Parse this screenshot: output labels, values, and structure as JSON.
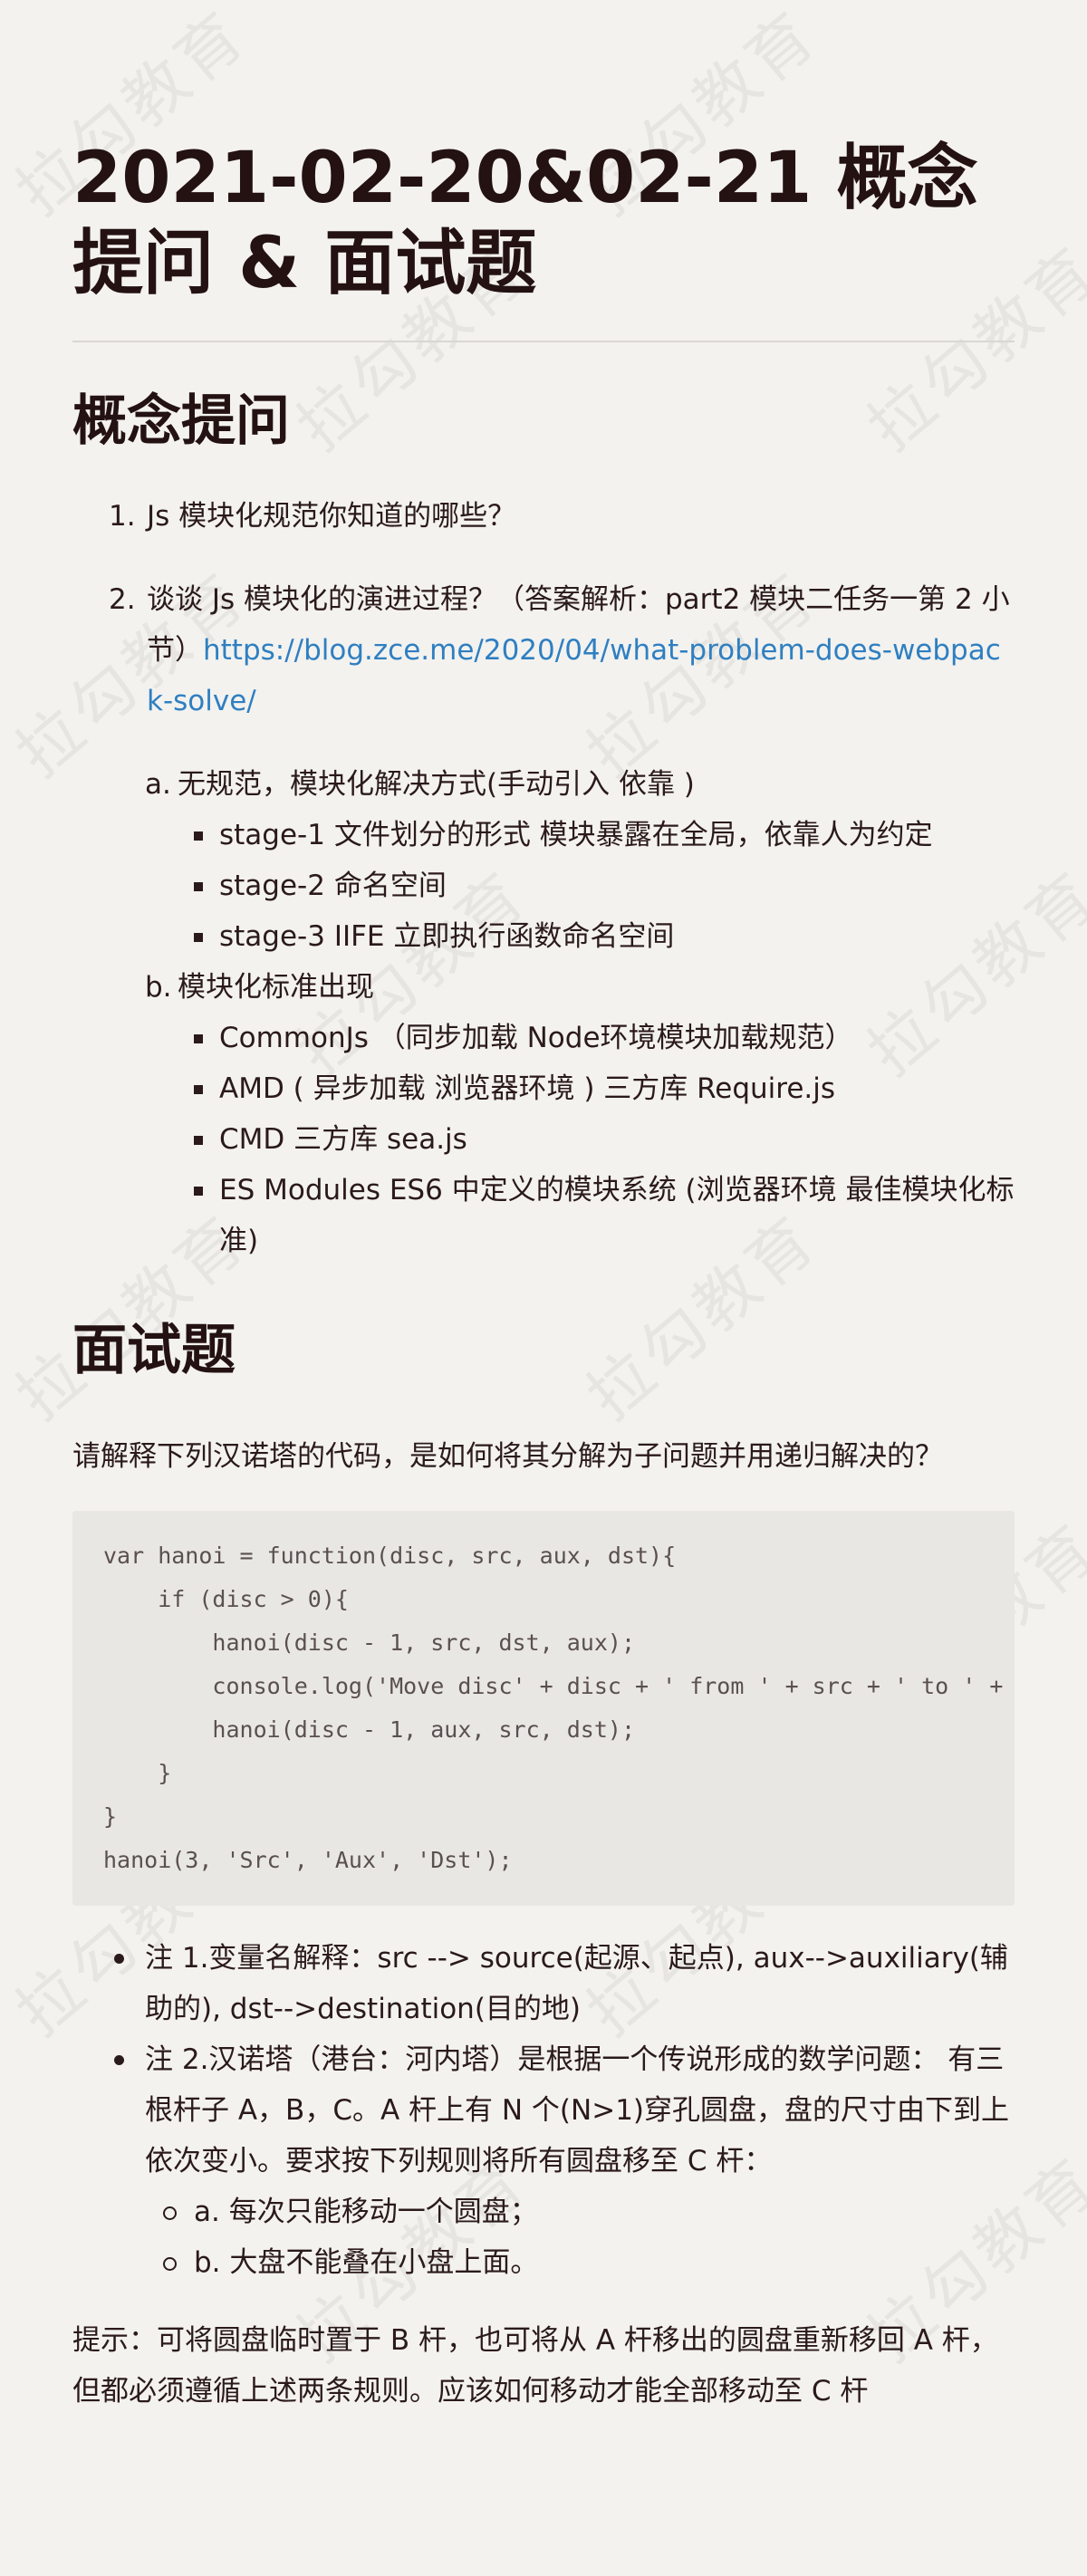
{
  "watermark": "拉勾教育",
  "title": "2021-02-20&02-21 概念提问 & 面试题",
  "section1": {
    "heading": "概念提问",
    "items": [
      {
        "num": "1.",
        "text": "Js 模块化规范你知道的哪些？"
      },
      {
        "num": "2.",
        "text": "谈谈 Js 模块化的演进过程？（答案解析：part2 模块二任务一第 2 小节）",
        "link": "https://blog.zce.me/2020/04/what-problem-does-webpack-solve/"
      }
    ],
    "subitems": [
      {
        "num": "a.",
        "text": "无规范，模块化解决方式(手动引入 依靠 )",
        "bullets": [
          "stage-1 文件划分的形式 模块暴露在全局，依靠人为约定",
          "stage-2 命名空间",
          "stage-3 IIFE 立即执行函数命名空间"
        ]
      },
      {
        "num": "b.",
        "text": "模块化标准出现",
        "bullets": [
          "CommonJs （同步加载 Node环境模块加载规范）",
          "AMD ( 异步加载 浏览器环境 ) 三方库 Require.js",
          "CMD 三方库 sea.js",
          "ES Modules ES6 中定义的模块系统 (浏览器环境 最佳模块化标准)"
        ]
      }
    ]
  },
  "section2": {
    "heading": "面试题",
    "intro": "请解释下列汉诺塔的代码，是如何将其分解为子问题并用递归解决的？",
    "code": "var hanoi = function(disc, src, aux, dst){\n    if (disc > 0){\n        hanoi(disc - 1, src, dst, aux);\n        console.log('Move disc' + disc + ' from ' + src + ' to ' + dst);\n        hanoi(disc - 1, aux, src, dst);\n    }\n}\nhanoi(3, 'Src', 'Aux', 'Dst');",
    "notes": [
      "注 1.变量名解释：src --> source(起源、起点), aux-->auxiliary(辅助的), dst-->destination(目的地)",
      "注 2.汉诺塔（港台：河内塔）是根据一个传说形成的数学问题： 有三根杆子 A，B，C。A 杆上有 N 个(N>1)穿孔圆盘，盘的尺寸由下到上依次变小。要求按下列规则将所有圆盘移至 C 杆："
    ],
    "rules": [
      "a. 每次只能移动一个圆盘；",
      "b. 大盘不能叠在小盘上面。"
    ],
    "hint": "提示：可将圆盘临时置于 B 杆，也可将从 A 杆移出的圆盘重新移回 A 杆，但都必须遵循上述两条规则。应该如何移动才能全部移动至 C 杆"
  }
}
